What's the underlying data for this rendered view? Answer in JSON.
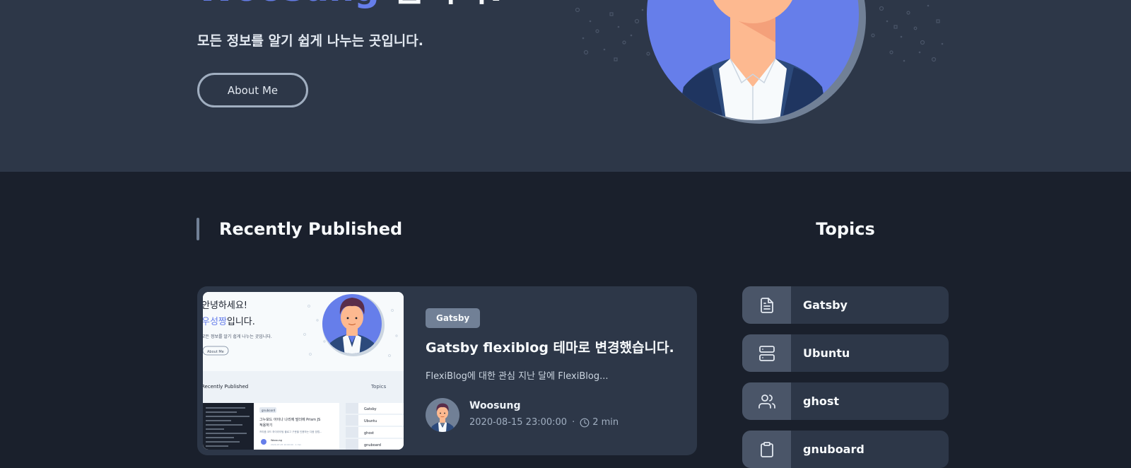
{
  "hero": {
    "title_highlight": "Woosung",
    "title_rest": "입니다.",
    "subtitle": "모든 정보를 알기 쉽게 나누는 곳입니다.",
    "about_button": "About Me"
  },
  "recent": {
    "heading": "Recently Published",
    "post": {
      "tag": "Gatsby",
      "title": "Gatsby flexiblog 테마로 변경했습니다.",
      "excerpt": "FlexiBlog에 대한 관심 지난 달에 FlexiBlog...",
      "author": "Woosung",
      "date": "2020-08-15 23:00:00",
      "separator": "·",
      "read_time": "2 min",
      "thumbnail": {
        "line1": "안녕하세요!",
        "line2_highlight": "우성짱",
        "line2_rest": "입니다.",
        "subtitle": "모든 정보를 알기 쉽게 나누는 곳입니다.",
        "button": "About Me",
        "recent_heading": "Recently Published",
        "topics_heading": "Topics",
        "card_tag": "gnuboard",
        "card_title_1": "그누보드 아이나 나리에 빌더에 Prism JS",
        "card_title_2": "적용하기",
        "card_excerpt": "프리즘 코드 하이라이팅 블로그 구문을 인용하는 다음 방법...",
        "card_author": "Woosung",
        "card_meta": "2020-07-25 10:00:00 · 1 min",
        "topics": [
          "Gatsby",
          "Ubuntu",
          "ghost",
          "gnuboard"
        ]
      }
    }
  },
  "topics": {
    "heading": "Topics",
    "items": [
      {
        "label": "Gatsby",
        "icon": "file-text-icon"
      },
      {
        "label": "Ubuntu",
        "icon": "server-icon"
      },
      {
        "label": "ghost",
        "icon": "users-icon"
      },
      {
        "label": "gnuboard",
        "icon": "clipboard-icon"
      }
    ]
  },
  "colors": {
    "hero_bg": "#2d3748",
    "page_bg": "#1a202c",
    "card_bg": "#2d3748",
    "accent": "#667eea",
    "tag_bg": "#718096",
    "icon_box_bg": "#4a5568"
  }
}
